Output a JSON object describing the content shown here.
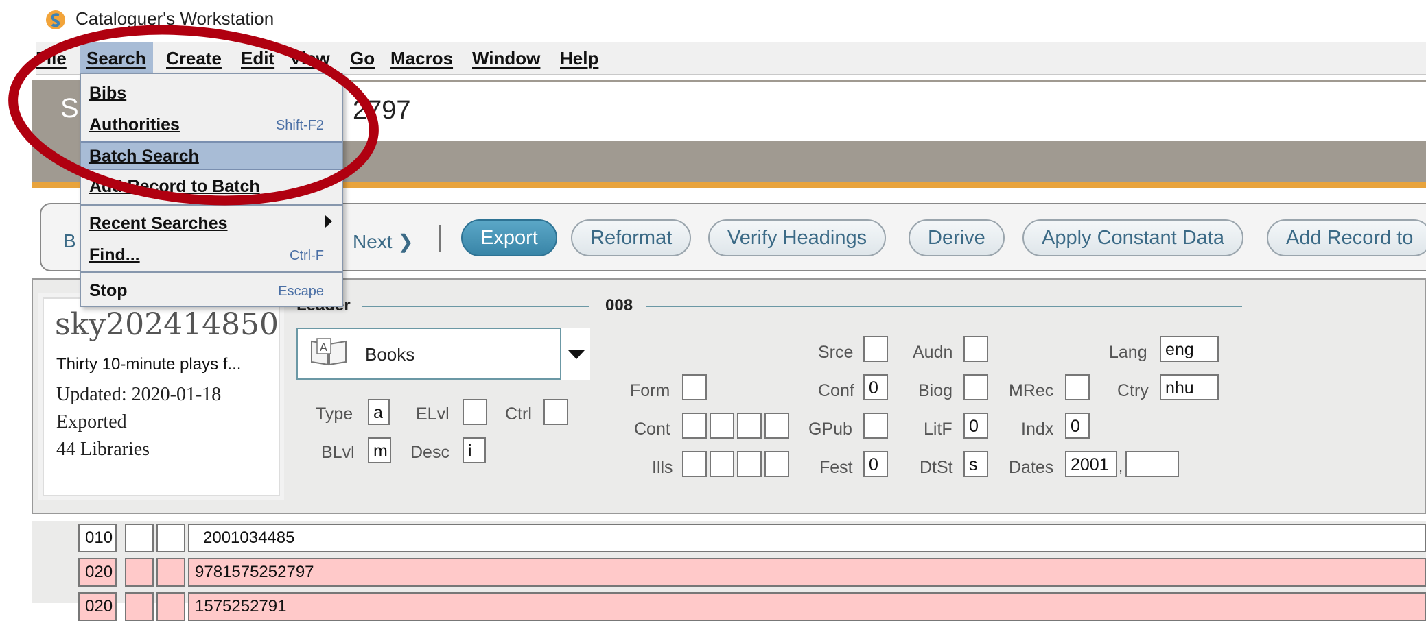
{
  "app": {
    "title": "Cataloguer's Workstation"
  },
  "menubar": {
    "items": [
      "File",
      "Search",
      "Create",
      "Edit",
      "View",
      "Go",
      "Macros",
      "Window",
      "Help"
    ]
  },
  "search_menu": {
    "items": [
      {
        "label": "Bibs",
        "shortcut": ""
      },
      {
        "label": "Authorities",
        "shortcut": "Shift-F2"
      },
      {
        "label": "Batch Search",
        "shortcut": ""
      },
      {
        "label": "Add Record to Batch",
        "shortcut": ""
      },
      {
        "label": "Recent Searches",
        "shortcut": ""
      },
      {
        "label": "Find...",
        "shortcut": "Ctrl-F"
      },
      {
        "label": "Stop",
        "shortcut": "Escape"
      }
    ]
  },
  "header": {
    "title_fragment": "2797",
    "left_letter": "S"
  },
  "toolbar": {
    "back_fragment": "B",
    "next_label": "Next",
    "buttons": [
      "Export",
      "Reformat",
      "Verify Headings",
      "Derive",
      "Apply Constant Data",
      "Add Record to"
    ]
  },
  "record": {
    "id": "sky202414850",
    "title": "Thirty 10-minute plays f...",
    "updated": "Updated: 2020-01-18",
    "status": "Exported",
    "libraries": "44 Libraries"
  },
  "leader": {
    "section_label": "Leader",
    "format": "Books",
    "fields": {
      "Type": "a",
      "ELvl": "",
      "Ctrl": "",
      "BLvl": "m",
      "Desc": "i"
    }
  },
  "f008": {
    "section_label": "008",
    "fields": {
      "Srce": "",
      "Audn": "",
      "Lang": "eng",
      "Form": "",
      "Conf": "0",
      "Biog": "",
      "MRec": "",
      "Ctry": "nhu",
      "Cont": "",
      "GPub": "",
      "LitF": "0",
      "Indx": "0",
      "Ills": "",
      "Fest": "0",
      "DtSt": "s",
      "Dates1": "2001",
      "Dates2": ""
    },
    "labels": {
      "Dates": "Dates"
    }
  },
  "marc_fields": [
    {
      "tag": "010",
      "value": "2001034485"
    },
    {
      "tag": "020",
      "value": "9781575252797"
    },
    {
      "tag": "020",
      "value": "1575252791"
    }
  ],
  "colors": {
    "accent": "#e8a33c",
    "highlight": "#a8bcd6",
    "annotation": "#b00010",
    "invalid_row": "#ffc9c9"
  }
}
